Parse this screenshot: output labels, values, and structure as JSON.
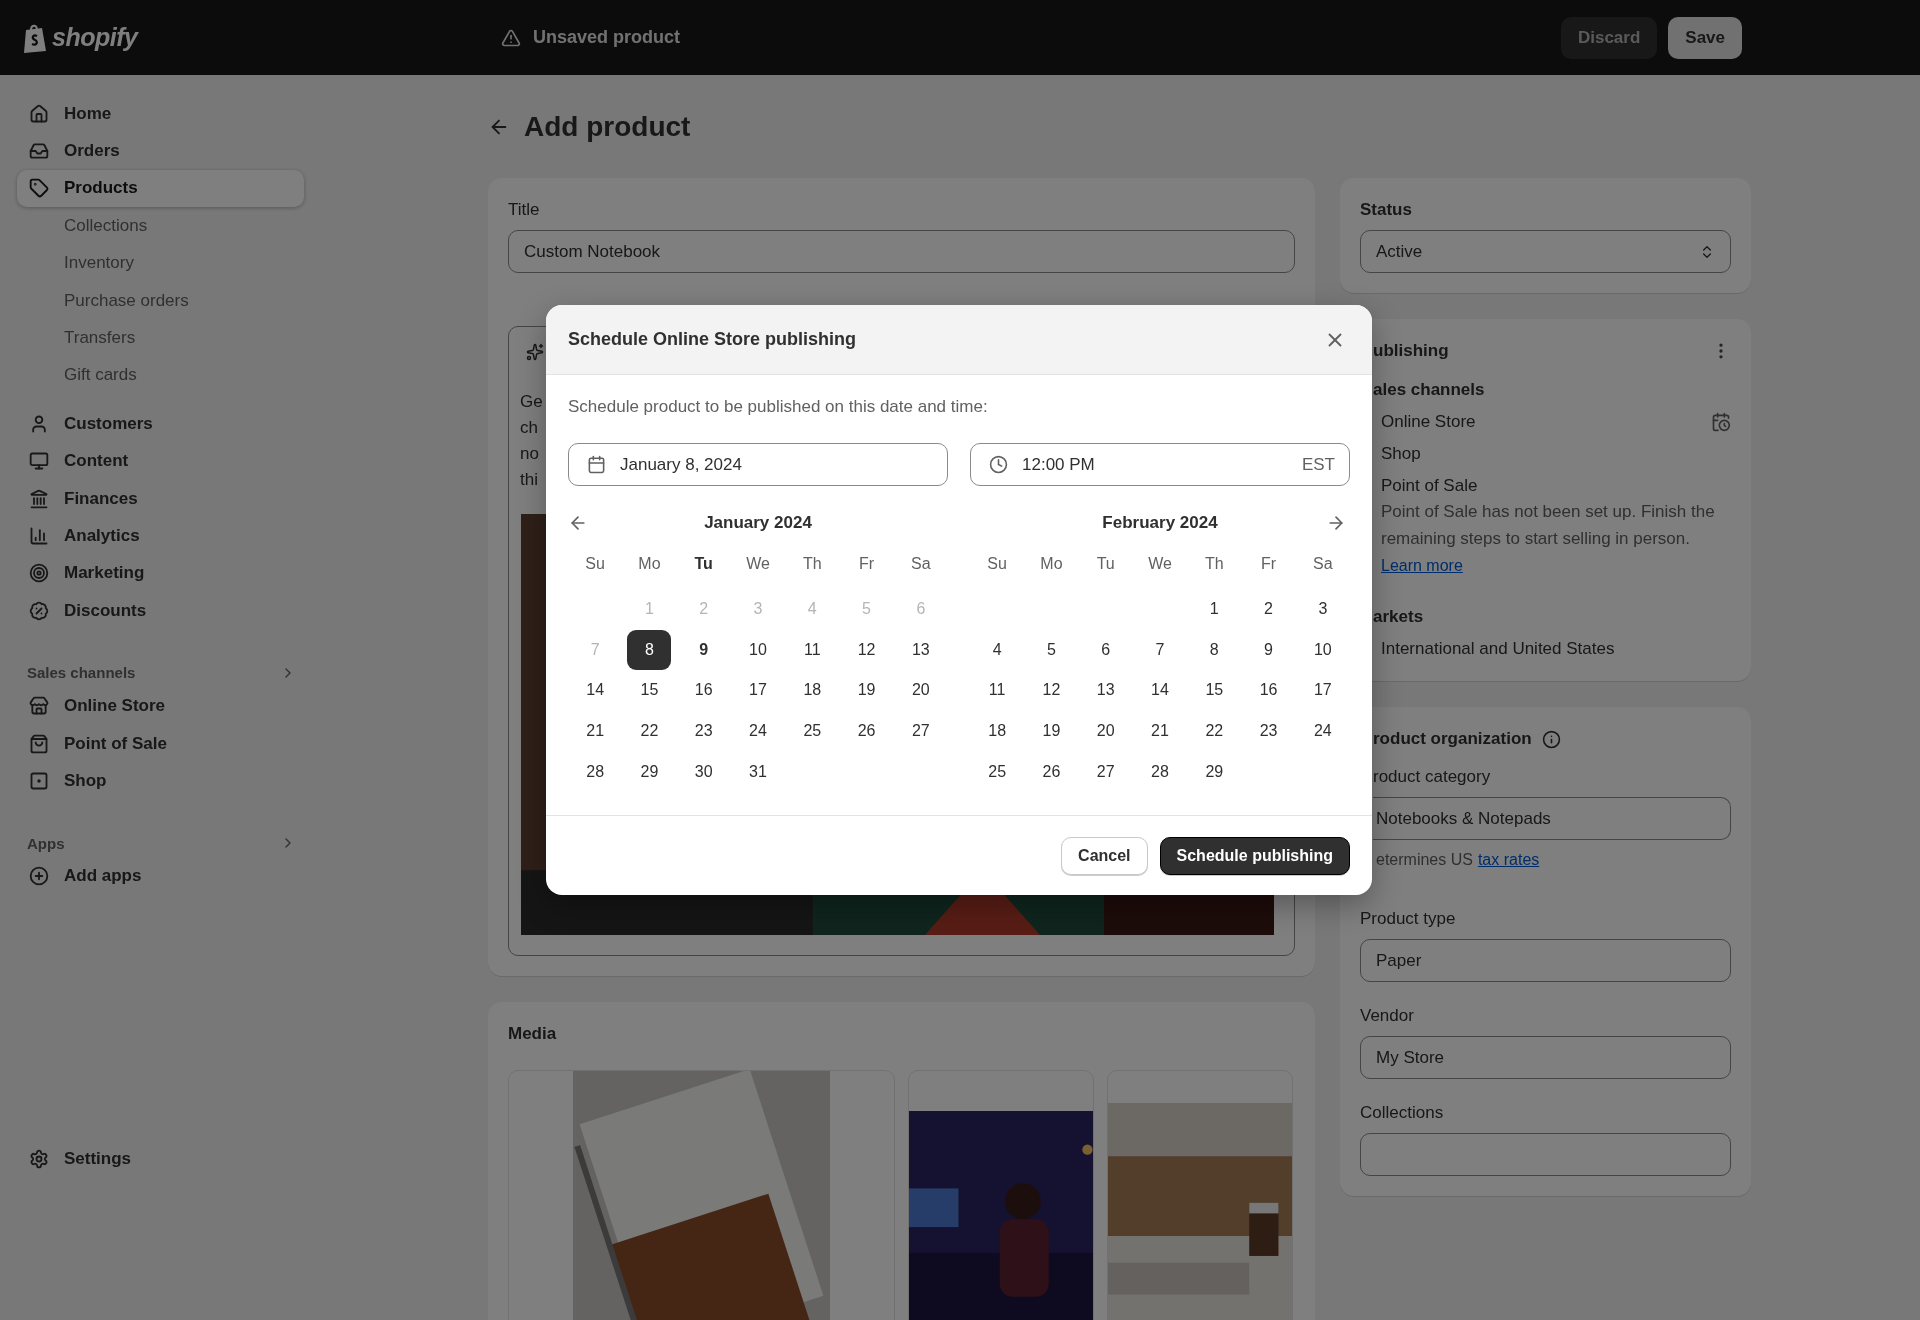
{
  "top_bar": {
    "logo": "shopify",
    "status": "Unsaved product",
    "buttons": [
      {
        "label": "Discard",
        "kind": "secondary"
      },
      {
        "label": "Save",
        "kind": "primary"
      }
    ]
  },
  "sidebar": {
    "groups": [
      {
        "items": [
          {
            "label": "Home",
            "kind": "home",
            "selected": false
          },
          {
            "label": "Orders",
            "kind": "orders",
            "selected": false
          },
          {
            "label": "Products",
            "kind": "products",
            "selected": true,
            "children": [
              {
                "label": "Collections",
                "selected": false
              },
              {
                "label": "Inventory",
                "selected": false
              },
              {
                "label": "Purchase orders",
                "selected": false
              },
              {
                "label": "Transfers",
                "selected": false
              },
              {
                "label": "Gift cards",
                "selected": false
              }
            ]
          }
        ]
      },
      {
        "items": [
          {
            "label": "Customers",
            "kind": "customers",
            "selected": false
          },
          {
            "label": "Content",
            "kind": "content",
            "selected": false
          },
          {
            "label": "Finances",
            "kind": "finances",
            "selected": false
          },
          {
            "label": "Analytics",
            "kind": "analytics",
            "selected": false
          },
          {
            "label": "Marketing",
            "kind": "marketing",
            "selected": false
          },
          {
            "label": "Discounts",
            "kind": "discounts",
            "selected": false
          }
        ]
      },
      {
        "title": "Sales channels",
        "items": [
          {
            "label": "Online Store",
            "kind": "store",
            "selected": false
          },
          {
            "label": "Point of Sale",
            "kind": "pos",
            "selected": false
          },
          {
            "label": "Shop",
            "kind": "shop",
            "selected": false
          }
        ]
      },
      {
        "title": "Apps",
        "items": [
          {
            "label": "Add apps",
            "kind": "add",
            "selected": false
          }
        ]
      }
    ],
    "settings": {
      "label": "Settings",
      "selected": false
    }
  },
  "page": {
    "title": "Add product"
  },
  "product_card": {
    "title_label": "Title",
    "title_value": "Custom Notebook",
    "description_fragments": [
      "Ge",
      "ch",
      "no",
      "thi"
    ]
  },
  "media_card": {
    "title": "Media"
  },
  "status_card": {
    "title": "Status",
    "value": "Active"
  },
  "publishing_card": {
    "title": "ublishing",
    "channels_title": "ales channels",
    "channels": [
      {
        "name": "Online Store",
        "scheduled": true
      },
      {
        "name": "Shop",
        "scheduled": false
      },
      {
        "name": "Point of Sale",
        "scheduled": false,
        "note": "Point of Sale has not been set up. Finish the remaining steps to start selling in person.",
        "link": "Learn more"
      }
    ],
    "markets_title": "arkets",
    "markets_value": "International and United States"
  },
  "organization_card": {
    "title": "roduct organization",
    "category_label": "roduct category",
    "category_value": "Notebooks & Notepads",
    "category_hint": "etermines US",
    "category_link": "tax rates",
    "fields": [
      {
        "label": "Product type",
        "value": "Paper"
      },
      {
        "label": "Vendor",
        "value": "My Store"
      },
      {
        "label": "Collections"
      }
    ]
  },
  "dialog": {
    "title": "Schedule Online Store publishing",
    "text": "Schedule product to be published on this date and time:",
    "date": "January 8, 2024",
    "time": "12:00 PM",
    "timezone": "EST",
    "months": [
      {
        "title": "January 2024",
        "weekdays": [
          {
            "label": "Su",
            "today": false
          },
          {
            "label": "Mo",
            "today": false
          },
          {
            "label": "Tu",
            "today": true
          },
          {
            "label": "We",
            "today": false
          },
          {
            "label": "Th",
            "today": false
          },
          {
            "label": "Fr",
            "today": false
          },
          {
            "label": "Sa",
            "today": false
          }
        ],
        "weeks": [
          [
            {
              "label": "1",
              "disabled": true,
              "selected": false,
              "today": false
            },
            {
              "label": "2",
              "disabled": true,
              "selected": false,
              "today": false
            },
            {
              "label": "3",
              "disabled": true,
              "selected": false,
              "today": false
            },
            {
              "label": "4",
              "disabled": true,
              "selected": false,
              "today": false
            },
            {
              "label": "5",
              "disabled": true,
              "selected": false,
              "today": false
            },
            {
              "label": "6",
              "disabled": true,
              "selected": false,
              "today": false
            }
          ],
          [
            {
              "label": "7",
              "disabled": true,
              "selected": false,
              "today": false
            },
            {
              "label": "8",
              "disabled": false,
              "selected": true,
              "today": false
            },
            {
              "label": "9",
              "disabled": false,
              "selected": false,
              "today": true
            },
            {
              "label": "10",
              "disabled": false,
              "selected": false,
              "today": false
            },
            {
              "label": "11",
              "disabled": false,
              "selected": false,
              "today": false
            },
            {
              "label": "12",
              "disabled": false,
              "selected": false,
              "today": false
            },
            {
              "label": "13",
              "disabled": false,
              "selected": false,
              "today": false
            }
          ],
          [
            {
              "label": "14",
              "disabled": false,
              "selected": false,
              "today": false
            },
            {
              "label": "15",
              "disabled": false,
              "selected": false,
              "today": false
            },
            {
              "label": "16",
              "disabled": false,
              "selected": false,
              "today": false
            },
            {
              "label": "17",
              "disabled": false,
              "selected": false,
              "today": false
            },
            {
              "label": "18",
              "disabled": false,
              "selected": false,
              "today": false
            },
            {
              "label": "19",
              "disabled": false,
              "selected": false,
              "today": false
            },
            {
              "label": "20",
              "disabled": false,
              "selected": false,
              "today": false
            }
          ],
          [
            {
              "label": "21",
              "disabled": false,
              "selected": false,
              "today": false
            },
            {
              "label": "22",
              "disabled": false,
              "selected": false,
              "today": false
            },
            {
              "label": "23",
              "disabled": false,
              "selected": false,
              "today": false
            },
            {
              "label": "24",
              "disabled": false,
              "selected": false,
              "today": false
            },
            {
              "label": "25",
              "disabled": false,
              "selected": false,
              "today": false
            },
            {
              "label": "26",
              "disabled": false,
              "selected": false,
              "today": false
            },
            {
              "label": "27",
              "disabled": false,
              "selected": false,
              "today": false
            }
          ],
          [
            {
              "label": "28",
              "disabled": false,
              "selected": false,
              "today": false
            },
            {
              "label": "29",
              "disabled": false,
              "selected": false,
              "today": false
            },
            {
              "label": "30",
              "disabled": false,
              "selected": false,
              "today": false
            },
            {
              "label": "31",
              "disabled": false,
              "selected": false,
              "today": false
            }
          ]
        ]
      },
      {
        "title": "February 2024",
        "weekdays": [
          {
            "label": "Su",
            "today": false
          },
          {
            "label": "Mo",
            "today": false
          },
          {
            "label": "Tu",
            "today": false
          },
          {
            "label": "We",
            "today": false
          },
          {
            "label": "Th",
            "today": false
          },
          {
            "label": "Fr",
            "today": false
          },
          {
            "label": "Sa",
            "today": false
          }
        ],
        "weeks": [
          [
            {
              "label": "1",
              "disabled": false,
              "selected": false,
              "today": false
            },
            {
              "label": "2",
              "disabled": false,
              "selected": false,
              "today": false
            },
            {
              "label": "3",
              "disabled": false,
              "selected": false,
              "today": false
            }
          ],
          [
            {
              "label": "4",
              "disabled": false,
              "selected": false,
              "today": false
            },
            {
              "label": "5",
              "disabled": false,
              "selected": false,
              "today": false
            },
            {
              "label": "6",
              "disabled": false,
              "selected": false,
              "today": false
            },
            {
              "label": "7",
              "disabled": false,
              "selected": false,
              "today": false
            },
            {
              "label": "8",
              "disabled": false,
              "selected": false,
              "today": false
            },
            {
              "label": "9",
              "disabled": false,
              "selected": false,
              "today": false
            },
            {
              "label": "10",
              "disabled": false,
              "selected": false,
              "today": false
            }
          ],
          [
            {
              "label": "11",
              "disabled": false,
              "selected": false,
              "today": false
            },
            {
              "label": "12",
              "disabled": false,
              "selected": false,
              "today": false
            },
            {
              "label": "13",
              "disabled": false,
              "selected": false,
              "today": false
            },
            {
              "label": "14",
              "disabled": false,
              "selected": false,
              "today": false
            },
            {
              "label": "15",
              "disabled": false,
              "selected": false,
              "today": false
            },
            {
              "label": "16",
              "disabled": false,
              "selected": false,
              "today": false
            },
            {
              "label": "17",
              "disabled": false,
              "selected": false,
              "today": false
            }
          ],
          [
            {
              "label": "18",
              "disabled": false,
              "selected": false,
              "today": false
            },
            {
              "label": "19",
              "disabled": false,
              "selected": false,
              "today": false
            },
            {
              "label": "20",
              "disabled": false,
              "selected": false,
              "today": false
            },
            {
              "label": "21",
              "disabled": false,
              "selected": false,
              "today": false
            },
            {
              "label": "22",
              "disabled": false,
              "selected": false,
              "today": false
            },
            {
              "label": "23",
              "disabled": false,
              "selected": false,
              "today": false
            },
            {
              "label": "24",
              "disabled": false,
              "selected": false,
              "today": false
            }
          ],
          [
            {
              "label": "25",
              "disabled": false,
              "selected": false,
              "today": false
            },
            {
              "label": "26",
              "disabled": false,
              "selected": false,
              "today": false
            },
            {
              "label": "27",
              "disabled": false,
              "selected": false,
              "today": false
            },
            {
              "label": "28",
              "disabled": false,
              "selected": false,
              "today": false
            },
            {
              "label": "29",
              "disabled": false,
              "selected": false,
              "today": false
            }
          ]
        ]
      }
    ],
    "buttons": [
      {
        "label": "Cancel",
        "kind": "secondary"
      },
      {
        "label": "Schedule publishing",
        "kind": "primary"
      }
    ]
  }
}
